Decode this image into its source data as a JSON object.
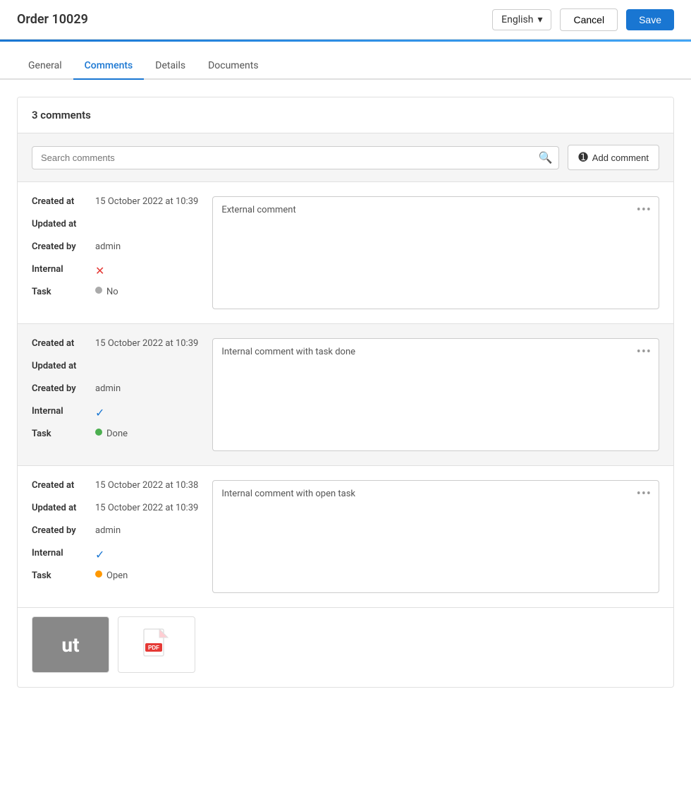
{
  "header": {
    "title": "Order 10029",
    "language": "English",
    "cancel_label": "Cancel",
    "save_label": "Save"
  },
  "tabs": [
    {
      "id": "general",
      "label": "General",
      "active": false
    },
    {
      "id": "comments",
      "label": "Comments",
      "active": true
    },
    {
      "id": "details",
      "label": "Details",
      "active": false
    },
    {
      "id": "documents",
      "label": "Documents",
      "active": false
    }
  ],
  "comments_section": {
    "heading": "3 comments",
    "search_placeholder": "Search comments",
    "add_comment_label": "Add comment"
  },
  "comments": [
    {
      "id": "c1",
      "alt": false,
      "created_at": "15 October 2022 at 10:39",
      "updated_at": "",
      "created_by": "admin",
      "internal": false,
      "task_status": "No",
      "task_dot": "grey",
      "text": "External comment"
    },
    {
      "id": "c2",
      "alt": true,
      "created_at": "15 October 2022 at 10:39",
      "updated_at": "",
      "created_by": "admin",
      "internal": true,
      "task_status": "Done",
      "task_dot": "green",
      "text": "Internal comment with task done"
    },
    {
      "id": "c3",
      "alt": false,
      "created_at": "15 October 2022 at 10:38",
      "updated_at": "15 October 2022 at 10:39",
      "created_by": "admin",
      "internal": true,
      "task_status": "Open",
      "task_dot": "orange",
      "text": "Internal comment with open task"
    }
  ],
  "labels": {
    "created_at": "Created at",
    "updated_at": "Updated at",
    "created_by": "Created by",
    "internal": "Internal",
    "task": "Task"
  },
  "attachments": [
    {
      "type": "text",
      "label": "ut"
    },
    {
      "type": "pdf",
      "label": "PDF"
    }
  ]
}
